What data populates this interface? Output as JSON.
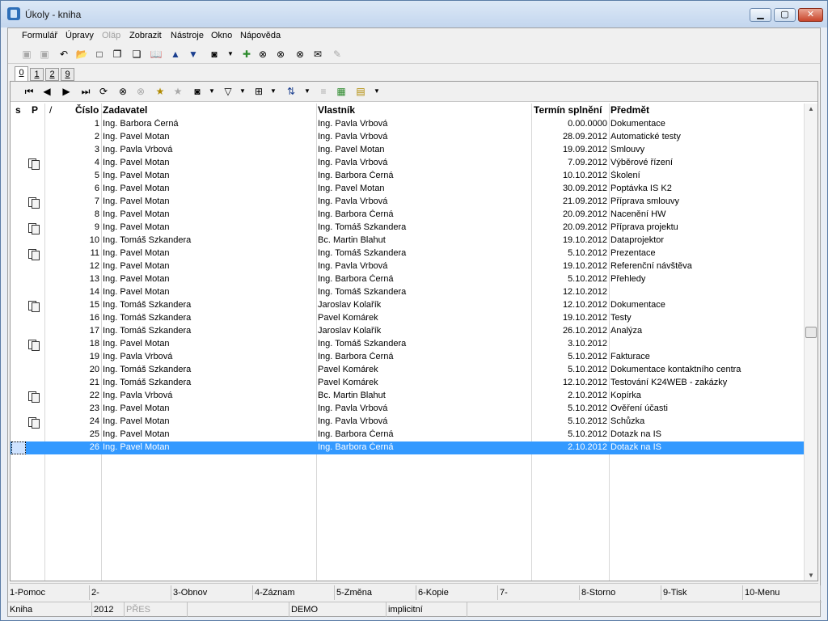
{
  "window": {
    "title": "Úkoly - kniha"
  },
  "menu": [
    {
      "label": "Formulář",
      "disabled": false
    },
    {
      "label": "Úpravy",
      "disabled": false
    },
    {
      "label": "Oläp",
      "disabled": true
    },
    {
      "label": "Zobrazit",
      "disabled": false
    },
    {
      "label": "Nástroje",
      "disabled": false
    },
    {
      "label": "Okno",
      "disabled": false
    },
    {
      "label": "Nápověda",
      "disabled": false
    }
  ],
  "tabs": [
    "0",
    "1",
    "2",
    "9"
  ],
  "columns": {
    "s": "s",
    "p": "P",
    "sort": "/",
    "cislo": "Číslo",
    "zadavatel": "Zadavatel",
    "vlastnik": "Vlastník",
    "termin": "Termín splnění",
    "predmet": "Předmět"
  },
  "rows": [
    {
      "cislo": "1",
      "zadavatel": "Ing. Barbora Černá",
      "vlastnik": "Ing. Pavla Vrbová",
      "termin": "0.00.0000",
      "predmet": "Dokumentace",
      "icon": false
    },
    {
      "cislo": "2",
      "zadavatel": "Ing. Pavel Motan",
      "vlastnik": "Ing. Pavla Vrbová",
      "termin": "28.09.2012",
      "predmet": "Automatické testy",
      "icon": false
    },
    {
      "cislo": "3",
      "zadavatel": "Ing. Pavla Vrbová",
      "vlastnik": "Ing. Pavel Motan",
      "termin": "19.09.2012",
      "predmet": "Smlouvy",
      "icon": false
    },
    {
      "cislo": "4",
      "zadavatel": "Ing. Pavel Motan",
      "vlastnik": "Ing. Pavla Vrbová",
      "termin": "7.09.2012",
      "predmet": "Výběrové řízení",
      "icon": true
    },
    {
      "cislo": "5",
      "zadavatel": "Ing. Pavel Motan",
      "vlastnik": "Ing. Barbora Černá",
      "termin": "10.10.2012",
      "predmet": "Školení",
      "icon": false
    },
    {
      "cislo": "6",
      "zadavatel": "Ing. Pavel Motan",
      "vlastnik": "Ing. Pavel Motan",
      "termin": "30.09.2012",
      "predmet": "Poptávka IS K2",
      "icon": false
    },
    {
      "cislo": "7",
      "zadavatel": "Ing. Pavel Motan",
      "vlastnik": "Ing. Pavla Vrbová",
      "termin": "21.09.2012",
      "predmet": "Příprava smlouvy",
      "icon": true
    },
    {
      "cislo": "8",
      "zadavatel": "Ing. Pavel Motan",
      "vlastnik": "Ing. Barbora Černá",
      "termin": "20.09.2012",
      "predmet": "Nacenění HW",
      "icon": false
    },
    {
      "cislo": "9",
      "zadavatel": "Ing. Pavel Motan",
      "vlastnik": "Ing. Tomáš Szkandera",
      "termin": "20.09.2012",
      "predmet": "Příprava projektu",
      "icon": true
    },
    {
      "cislo": "10",
      "zadavatel": "Ing. Tomáš Szkandera",
      "vlastnik": "Bc. Martin Blahut",
      "termin": "19.10.2012",
      "predmet": "Dataprojektor",
      "icon": false
    },
    {
      "cislo": "11",
      "zadavatel": "Ing. Pavel Motan",
      "vlastnik": "Ing. Tomáš Szkandera",
      "termin": "5.10.2012",
      "predmet": "Prezentace",
      "icon": true
    },
    {
      "cislo": "12",
      "zadavatel": "Ing. Pavel Motan",
      "vlastnik": "Ing. Pavla Vrbová",
      "termin": "19.10.2012",
      "predmet": "Referenční návštěva",
      "icon": false
    },
    {
      "cislo": "13",
      "zadavatel": "Ing. Pavel Motan",
      "vlastnik": "Ing. Barbora Černá",
      "termin": "5.10.2012",
      "predmet": "Přehledy",
      "icon": false
    },
    {
      "cislo": "14",
      "zadavatel": "Ing. Pavel Motan",
      "vlastnik": "Ing. Tomáš Szkandera",
      "termin": "12.10.2012",
      "predmet": "",
      "icon": false
    },
    {
      "cislo": "15",
      "zadavatel": "Ing. Tomáš Szkandera",
      "vlastnik": "Jaroslav Kolařík",
      "termin": "12.10.2012",
      "predmet": "Dokumentace",
      "icon": true
    },
    {
      "cislo": "16",
      "zadavatel": "Ing. Tomáš Szkandera",
      "vlastnik": "Pavel Komárek",
      "termin": "19.10.2012",
      "predmet": "Testy",
      "icon": false
    },
    {
      "cislo": "17",
      "zadavatel": "Ing. Tomáš Szkandera",
      "vlastnik": "Jaroslav Kolařík",
      "termin": "26.10.2012",
      "predmet": "Analýza",
      "icon": false
    },
    {
      "cislo": "18",
      "zadavatel": "Ing. Pavel Motan",
      "vlastnik": "Ing. Tomáš Szkandera",
      "termin": "3.10.2012",
      "predmet": "",
      "icon": true
    },
    {
      "cislo": "19",
      "zadavatel": "Ing. Pavla Vrbová",
      "vlastnik": "Ing. Barbora Černá",
      "termin": "5.10.2012",
      "predmet": "Fakturace",
      "icon": false
    },
    {
      "cislo": "20",
      "zadavatel": "Ing. Tomáš Szkandera",
      "vlastnik": "Pavel Komárek",
      "termin": "5.10.2012",
      "predmet": "Dokumentace kontaktního centra",
      "icon": false
    },
    {
      "cislo": "21",
      "zadavatel": "Ing. Tomáš Szkandera",
      "vlastnik": "Pavel Komárek",
      "termin": "12.10.2012",
      "predmet": "Testování K24WEB - zakázky",
      "icon": false
    },
    {
      "cislo": "22",
      "zadavatel": "Ing. Pavla Vrbová",
      "vlastnik": "Bc. Martin Blahut",
      "termin": "2.10.2012",
      "predmet": "Kopírka",
      "icon": true
    },
    {
      "cislo": "23",
      "zadavatel": "Ing. Pavel Motan",
      "vlastnik": "Ing. Pavla Vrbová",
      "termin": "5.10.2012",
      "predmet": "Ověření účasti",
      "icon": false
    },
    {
      "cislo": "24",
      "zadavatel": "Ing. Pavel Motan",
      "vlastnik": "Ing. Pavla Vrbová",
      "termin": "5.10.2012",
      "predmet": "Schůzka",
      "icon": true
    },
    {
      "cislo": "25",
      "zadavatel": "Ing. Pavel Motan",
      "vlastnik": "Ing. Barbora Černá",
      "termin": "5.10.2012",
      "predmet": "Dotazk na IS",
      "icon": false
    },
    {
      "cislo": "26",
      "zadavatel": "Ing. Pavel Motan",
      "vlastnik": "Ing. Barbora Černá",
      "termin": "2.10.2012",
      "predmet": "Dotazk na IS",
      "icon": false,
      "selected": true
    }
  ],
  "fkeys": [
    "1-Pomoc",
    "2-",
    "3-Obnov",
    "4-Záznam",
    "5-Změna",
    "6-Kopie",
    "7-",
    "8-Storno",
    "9-Tisk",
    "10-Menu"
  ],
  "status": [
    "Kniha",
    "2012",
    "PŘES",
    "",
    "DEMO",
    "implicitní",
    ""
  ],
  "icons": {
    "toolbar1": [
      "save-icon",
      "save-all-icon",
      "undo-icon",
      "open-folder-icon",
      "new-document-icon",
      "copy-icon",
      "paste-icon",
      "book-icon",
      "arrow-up-icon",
      "arrow-down-icon",
      "camera-icon",
      "filter-icon",
      "binoculars-icon",
      "find-next-icon",
      "find-prev-icon",
      "mail-icon",
      "edit-icon"
    ],
    "toolbar2": [
      "first-record-icon",
      "prev-record-icon",
      "next-record-icon",
      "last-record-icon",
      "refresh-icon",
      "search-icon",
      "search-disabled-icon",
      "add-star-icon",
      "remove-star-icon",
      "camera-icon",
      "filter-icon",
      "columns-icon",
      "sort-icon",
      "tree-icon",
      "excel-icon",
      "report-icon"
    ]
  }
}
